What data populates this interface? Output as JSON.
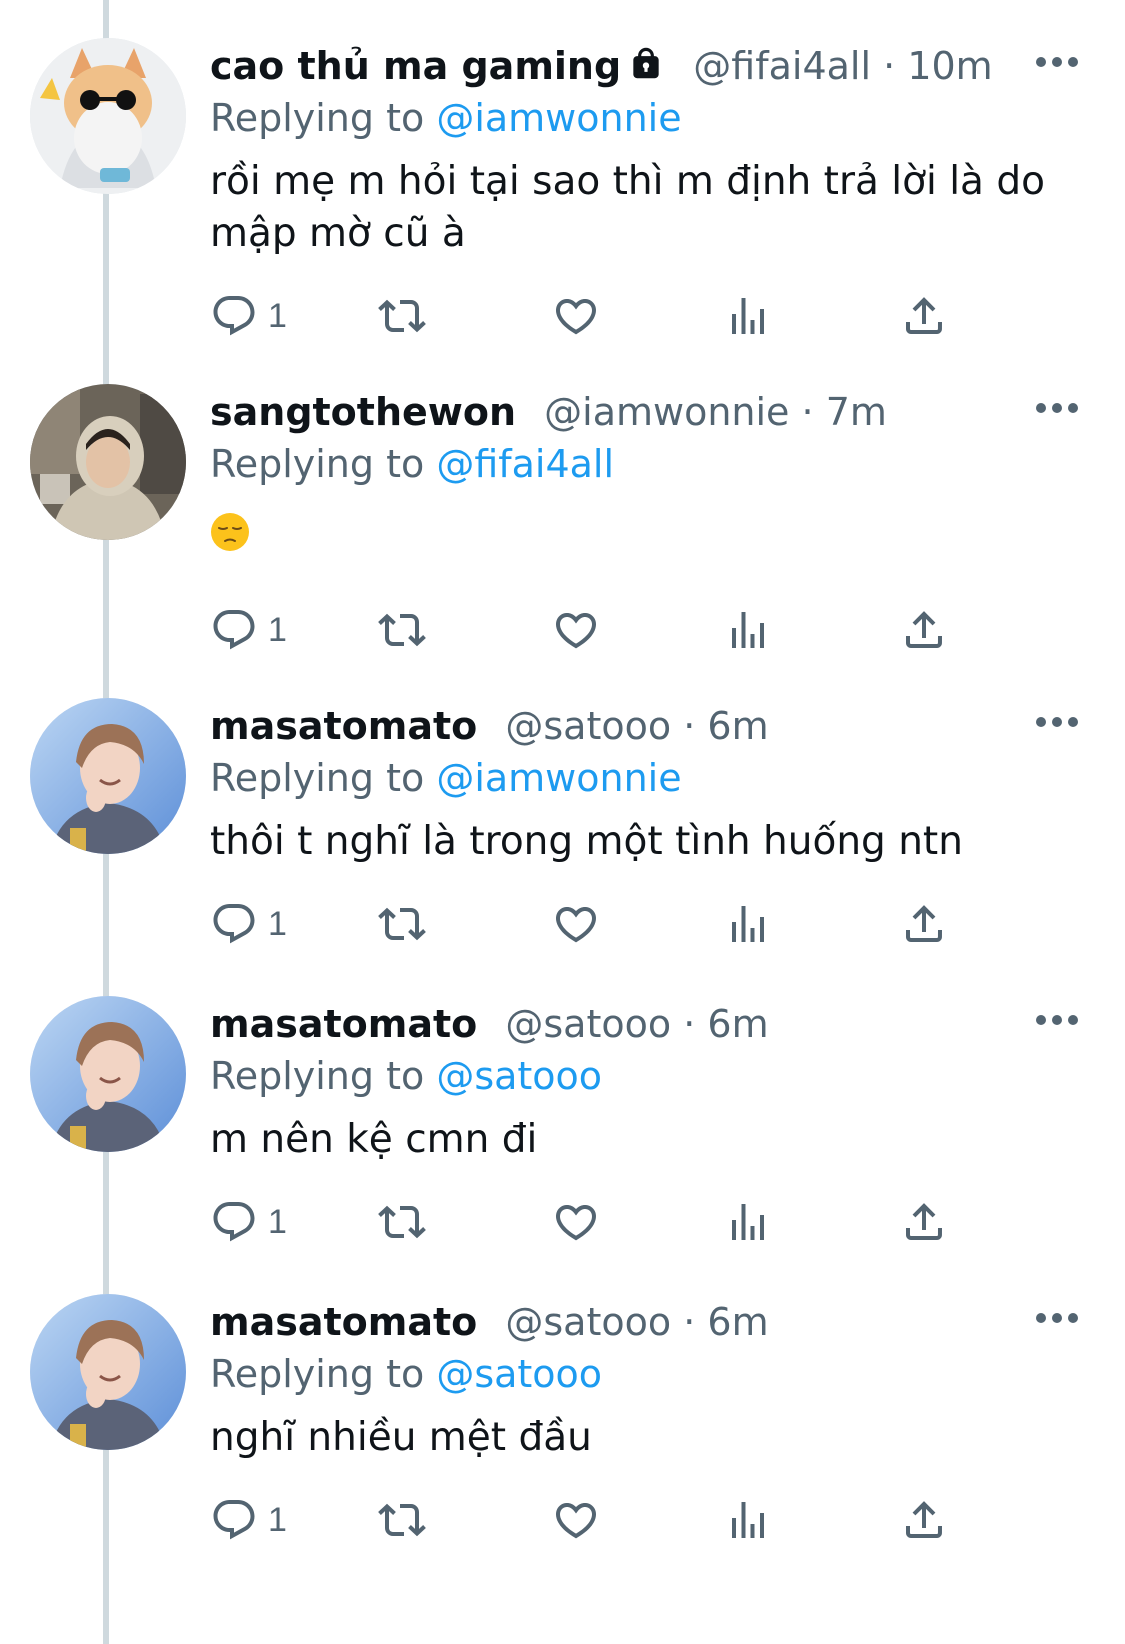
{
  "thread": {
    "tweets": [
      {
        "name": "cao thủ ma gaming",
        "protected": true,
        "handle": "@fifai4all",
        "separator": "·",
        "time": "10m",
        "replying_prefix": "Replying to ",
        "replying_to": "@iamwonnie",
        "text": "rồi mẹ m hỏi tại sao thì m định trả lời là do mập mờ cũ à",
        "reply_count": "1",
        "avatar_icon": "cat-with-sunglasses-avatar"
      },
      {
        "name": "sangtothewon",
        "protected": false,
        "handle": "@iamwonnie",
        "separator": "·",
        "time": "7m",
        "replying_prefix": "Replying to ",
        "replying_to": "@fifai4all",
        "text": "",
        "emoji": "pensive-face-emoji",
        "reply_count": "1",
        "avatar_icon": "person-in-hoodie-avatar"
      },
      {
        "name": "masatomato",
        "protected": false,
        "handle": "@satooo",
        "separator": "·",
        "time": "6m",
        "replying_prefix": "Replying to ",
        "replying_to": "@iamwonnie",
        "text": "thôi t nghĩ là trong một tình huống ntn",
        "reply_count": "1",
        "avatar_icon": "smiling-boy-avatar"
      },
      {
        "name": "masatomato",
        "protected": false,
        "handle": "@satooo",
        "separator": "·",
        "time": "6m",
        "replying_prefix": "Replying to ",
        "replying_to": "@satooo",
        "text": "m nên kệ cmn đi",
        "reply_count": "1",
        "avatar_icon": "smiling-boy-avatar"
      },
      {
        "name": "masatomato",
        "protected": false,
        "handle": "@satooo",
        "separator": "·",
        "time": "6m",
        "replying_prefix": "Replying to ",
        "replying_to": "@satooo",
        "text": "nghĩ nhiều mệt đầu",
        "reply_count": "1",
        "avatar_icon": "smiling-boy-avatar"
      }
    ]
  },
  "icons": {
    "reply": "reply-icon",
    "retweet": "retweet-icon",
    "like": "heart-icon",
    "views": "views-icon",
    "share": "share-icon",
    "more": "more-icon",
    "lock": "lock-icon"
  },
  "colors": {
    "link": "#1d9bf0",
    "secondary_text": "#536471",
    "primary_text": "#0f1419",
    "thread_line": "#cfd9de"
  }
}
